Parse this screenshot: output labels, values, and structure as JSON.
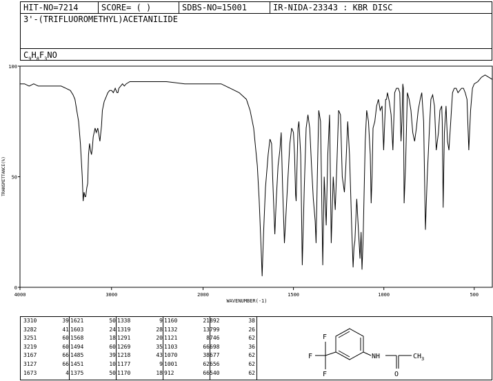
{
  "header": {
    "hit_no": "HIT-NO=7214",
    "score": "SCORE=  (   )",
    "sdbs_no": "SDBS-NO=15001",
    "ir_info": "IR-NIDA-23343 : KBR DISC"
  },
  "compound_name": "3'-(TRIFLUOROMETHYL)ACETANILIDE",
  "formula": {
    "c": "C",
    "c_n": "9",
    "h": "H",
    "h_n": "8",
    "f": "F",
    "f_n": "3",
    "rest": "NO"
  },
  "chart_data": {
    "type": "line",
    "xlabel": "WAVENUMBER(-1)",
    "ylabel": "TRANSMITTANCE(%)",
    "xlim": [
      4000,
      400
    ],
    "ylim": [
      0,
      100
    ],
    "x_ticks": [
      "4000",
      "3000",
      "2000",
      "1500",
      "1000",
      "500"
    ],
    "y_ticks": [
      "100",
      "50",
      "0"
    ],
    "series": [
      {
        "x": [
          4000,
          3950,
          3900,
          3850,
          3800,
          3700,
          3600,
          3550,
          3500,
          3450,
          3420,
          3400,
          3380,
          3360,
          3340,
          3320,
          3310,
          3300,
          3290,
          3282,
          3270,
          3260,
          3251,
          3240,
          3230,
          3219,
          3210,
          3200,
          3180,
          3167,
          3150,
          3127,
          3110,
          3100,
          3080,
          3060,
          3040,
          3020,
          3000,
          2980,
          2960,
          2950,
          2940,
          2930,
          2920,
          2900,
          2880,
          2860,
          2840,
          2800,
          2600,
          2400,
          2200,
          2000,
          1900,
          1850,
          1800,
          1760,
          1740,
          1720,
          1700,
          1690,
          1680,
          1673,
          1665,
          1655,
          1640,
          1630,
          1621,
          1615,
          1603,
          1595,
          1585,
          1575,
          1568,
          1560,
          1550,
          1540,
          1530,
          1520,
          1510,
          1500,
          1494,
          1488,
          1485,
          1480,
          1475,
          1470,
          1460,
          1451,
          1440,
          1430,
          1420,
          1410,
          1400,
          1390,
          1380,
          1375,
          1368,
          1360,
          1350,
          1338,
          1330,
          1319,
          1310,
          1300,
          1291,
          1280,
          1269,
          1260,
          1250,
          1240,
          1230,
          1218,
          1210,
          1200,
          1190,
          1177,
          1170,
          1165,
          1160,
          1150,
          1140,
          1132,
          1126,
          1121,
          1115,
          1103,
          1095,
          1085,
          1075,
          1070,
          1065,
          1060,
          1050,
          1040,
          1030,
          1020,
          1010,
          1001,
          995,
          990,
          985,
          980,
          970,
          960,
          950,
          940,
          930,
          920,
          912,
          905,
          900,
          895,
          892,
          888,
          880,
          870,
          860,
          850,
          840,
          830,
          820,
          810,
          799,
          790,
          780,
          770,
          760,
          746,
          740,
          730,
          720,
          710,
          698,
          690,
          680,
          677,
          672,
          665,
          656,
          648,
          640,
          630,
          620,
          610,
          600,
          590,
          580,
          570,
          560,
          550,
          540,
          530,
          520,
          510,
          500,
          480,
          460,
          440,
          420,
          400
        ],
        "y": [
          92,
          92,
          91,
          92,
          91,
          91,
          91,
          91,
          90,
          89,
          87,
          85,
          80,
          75,
          65,
          50,
          39,
          43,
          41,
          41,
          45,
          47,
          60,
          65,
          62,
          60,
          63,
          68,
          72,
          70,
          72,
          66,
          73,
          80,
          84,
          86,
          88,
          89,
          89,
          88,
          90,
          89,
          88,
          88,
          90,
          91,
          92,
          91,
          92,
          93,
          93,
          93,
          92,
          92,
          92,
          90,
          88,
          85,
          80,
          72,
          55,
          40,
          20,
          5,
          25,
          45,
          60,
          67,
          65,
          50,
          24,
          40,
          55,
          62,
          70,
          45,
          20,
          35,
          50,
          65,
          72,
          70,
          60,
          42,
          39,
          55,
          72,
          75,
          60,
          10,
          45,
          72,
          78,
          72,
          55,
          40,
          30,
          20,
          50,
          80,
          75,
          10,
          50,
          28,
          60,
          78,
          20,
          50,
          35,
          55,
          80,
          78,
          50,
          43,
          55,
          75,
          60,
          25,
          9,
          18,
          21,
          40,
          25,
          13,
          25,
          8,
          20,
          66,
          80,
          75,
          60,
          38,
          50,
          72,
          75,
          82,
          85,
          80,
          82,
          62,
          75,
          85,
          85,
          88,
          84,
          78,
          62,
          88,
          90,
          90,
          88,
          66,
          75,
          92,
          90,
          38,
          55,
          88,
          85,
          80,
          70,
          66,
          72,
          80,
          85,
          88,
          75,
          26,
          50,
          75,
          85,
          87,
          82,
          62,
          70,
          80,
          82,
          75,
          36,
          70,
          82,
          66,
          62,
          75,
          88,
          90,
          90,
          88,
          89,
          90,
          90,
          88,
          85,
          62,
          80,
          90,
          92,
          93,
          95,
          96,
          95,
          94
        ]
      }
    ]
  },
  "peak_table": {
    "columns": [
      [
        [
          "3310",
          "39"
        ],
        [
          "3282",
          "41"
        ],
        [
          "3251",
          "60"
        ],
        [
          "3219",
          "60"
        ],
        [
          "3167",
          "66"
        ],
        [
          "3127",
          "66"
        ],
        [
          "1673",
          "4"
        ]
      ],
      [
        [
          "1621",
          "50"
        ],
        [
          "1603",
          "24"
        ],
        [
          "1568",
          "18"
        ],
        [
          "1494",
          "60"
        ],
        [
          "1485",
          "39"
        ],
        [
          "1451",
          "10"
        ],
        [
          "1375",
          "50"
        ]
      ],
      [
        [
          "1338",
          "9"
        ],
        [
          "1319",
          "28"
        ],
        [
          "1291",
          "20"
        ],
        [
          "1269",
          "35"
        ],
        [
          "1218",
          "43"
        ],
        [
          "1177",
          "9"
        ],
        [
          "1170",
          "18"
        ]
      ],
      [
        [
          "1160",
          "21"
        ],
        [
          "1132",
          "13"
        ],
        [
          "1121",
          "8"
        ],
        [
          "1103",
          "66"
        ],
        [
          "1070",
          "38"
        ],
        [
          "1001",
          "62"
        ],
        [
          "912",
          "66"
        ]
      ],
      [
        [
          "892",
          "38"
        ],
        [
          "799",
          "26"
        ],
        [
          "746",
          "62"
        ],
        [
          "698",
          "36"
        ],
        [
          "677",
          "62"
        ],
        [
          "656",
          "62"
        ],
        [
          "540",
          "62"
        ]
      ]
    ]
  },
  "structure": {
    "f_top": "F",
    "f_left": "F",
    "f_bottom": "F",
    "nh": "NH",
    "o": "O",
    "ch": "CH",
    "ch_sub": "3"
  }
}
